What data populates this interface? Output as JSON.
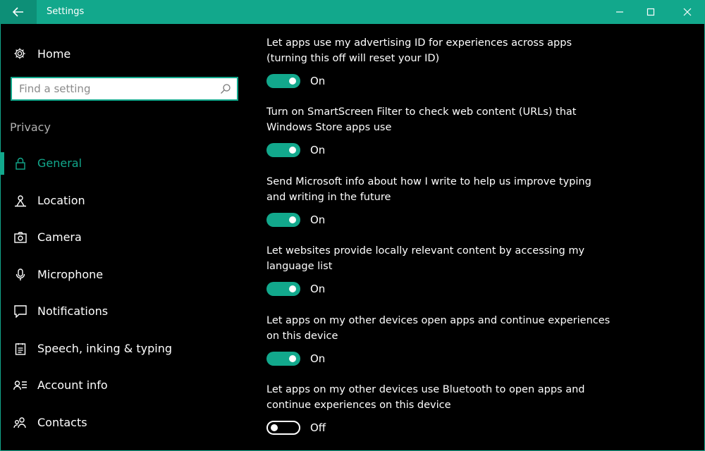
{
  "window": {
    "title": "Settings"
  },
  "sidebar": {
    "home_label": "Home",
    "search_placeholder": "Find a setting",
    "section_label": "Privacy",
    "items": [
      {
        "label": "General",
        "icon": "lock-icon",
        "active": true
      },
      {
        "label": "Location",
        "icon": "location-icon",
        "active": false
      },
      {
        "label": "Camera",
        "icon": "camera-icon",
        "active": false
      },
      {
        "label": "Microphone",
        "icon": "microphone-icon",
        "active": false
      },
      {
        "label": "Notifications",
        "icon": "notifications-icon",
        "active": false
      },
      {
        "label": "Speech, inking & typing",
        "icon": "speech-icon",
        "active": false
      },
      {
        "label": "Account info",
        "icon": "account-info-icon",
        "active": false
      },
      {
        "label": "Contacts",
        "icon": "contacts-icon",
        "active": false
      }
    ]
  },
  "settings": [
    {
      "line1": "Let apps use my advertising ID for experiences across apps",
      "line2": "(turning this off will reset your ID)",
      "state": "On"
    },
    {
      "line1": "Turn on SmartScreen Filter to check web content (URLs) that",
      "line2": "Windows Store apps use",
      "state": "On"
    },
    {
      "line1": "Send Microsoft info about how I write to help us improve typing",
      "line2": "and writing in the future",
      "state": "On"
    },
    {
      "line1": "Let websites provide locally relevant content by accessing my",
      "line2": "language list",
      "state": "On"
    },
    {
      "line1": "Let apps on my other devices open apps and continue experiences",
      "line2": "on this device",
      "state": "On"
    },
    {
      "line1": "Let apps on my other devices use Bluetooth to open apps and",
      "line2": "continue experiences on this device",
      "state": "Off"
    }
  ],
  "colors": {
    "accent": "#12a88c",
    "background": "#000000"
  }
}
